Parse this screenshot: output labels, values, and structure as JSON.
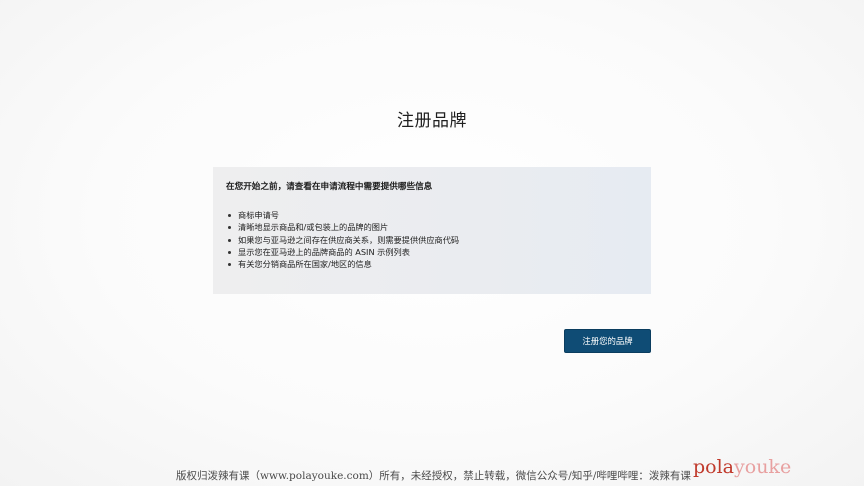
{
  "page": {
    "title": "注册品牌"
  },
  "info": {
    "heading": "在您开始之前，请查看在申请流程中需要提供哪些信息",
    "items": [
      "商标申请号",
      "清晰地显示商品和/或包装上的品牌的图片",
      "如果您与亚马逊之间存在供应商关系，则需要提供供应商代码",
      "显示您在亚马逊上的品牌商品的 ASIN 示例列表",
      "有关您分销商品所在国家/地区的信息"
    ]
  },
  "actions": {
    "register_label": "注册您的品牌",
    "button_color": "#0f4c75"
  },
  "watermark": {
    "text": "版权归泼辣有课（www.polayouke.com）所有，未经授权，禁止转载，微信公众号/知乎/哔哩哔哩：泼辣有课",
    "logo": "polayouke"
  }
}
